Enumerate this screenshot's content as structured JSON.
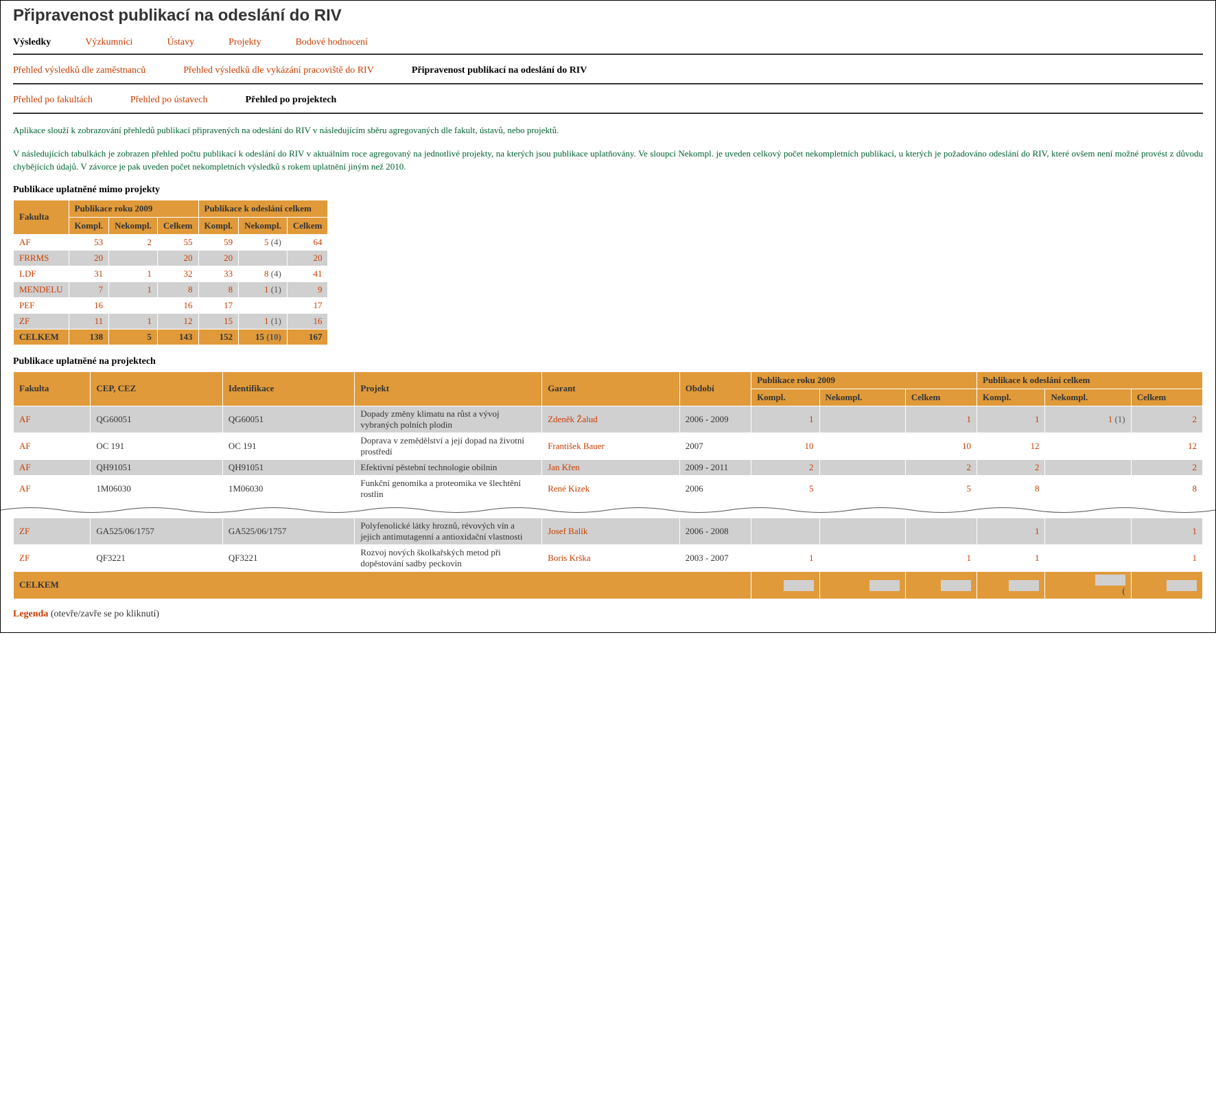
{
  "title": "Připravenost publikací na odeslání do RIV",
  "tabs1": [
    "Výsledky",
    "Výzkumníci",
    "Ústavy",
    "Projekty",
    "Bodové hodnocení"
  ],
  "tabs1_active": 0,
  "tabs2": [
    "Přehled výsledků dle zaměstnanců",
    "Přehled výsledků dle vykázání pracoviště do RIV",
    "Připravenost publikací na odeslání do RIV"
  ],
  "tabs2_active": 2,
  "tabs3": [
    "Přehled po fakultách",
    "Přehled po ústavech",
    "Přehled po projektech"
  ],
  "tabs3_active": 2,
  "desc1": "Aplikace slouží k zobrazování přehledů publikací připravených na odeslání do RIV v následujícím sběru agregovaných dle fakult, ústavů, nebo projektů.",
  "desc2": "V následujících tabulkách je zobrazen přehled počtu publikací k odeslání do RIV v aktuálním roce agregovaný na jednotlivé projekty, na kterých jsou publikace uplatňovány. Ve sloupci Nekompl. je uveden celkový počet nekompletních publikací, u kterých je požadováno odeslání do RIV, které ovšem není možné provést z důvodu chybějících údajů. V závorce je pak uveden počet nekompletních výsledků s rokem uplatnění jiným než 2010.",
  "sec1_title": "Publikace uplatněné mimo projekty",
  "sec2_title": "Publikace uplatněné na projektech",
  "h": {
    "fakulta": "Fakulta",
    "cep": "CEP, CEZ",
    "ident": "Identifikace",
    "projekt": "Projekt",
    "garant": "Garant",
    "obdobi": "Období",
    "pub2009": "Publikace roku 2009",
    "pubcelk": "Publikace k odeslání celkem",
    "kompl": "Kompl.",
    "nekompl": "Nekompl.",
    "celkem": "Celkem"
  },
  "t1_rows": [
    {
      "f": "AF",
      "a": "53",
      "b": "2",
      "c": "55",
      "d": "59",
      "e": "5",
      "ep": "4",
      "g": "64"
    },
    {
      "f": "FRRMS",
      "a": "20",
      "b": "",
      "c": "20",
      "d": "20",
      "e": "",
      "ep": "",
      "g": "20"
    },
    {
      "f": "LDF",
      "a": "31",
      "b": "1",
      "c": "32",
      "d": "33",
      "e": "8",
      "ep": "4",
      "g": "41"
    },
    {
      "f": "MENDELU",
      "a": "7",
      "b": "1",
      "c": "8",
      "d": "8",
      "e": "1",
      "ep": "1",
      "g": "9"
    },
    {
      "f": "PEF",
      "a": "16",
      "b": "",
      "c": "16",
      "d": "17",
      "e": "",
      "ep": "",
      "g": "17"
    },
    {
      "f": "ZF",
      "a": "11",
      "b": "1",
      "c": "12",
      "d": "15",
      "e": "1",
      "ep": "1",
      "g": "16"
    }
  ],
  "t1_total": {
    "label": "CELKEM",
    "a": "138",
    "b": "5",
    "c": "143",
    "d": "152",
    "e": "15",
    "ep": "10",
    "g": "167"
  },
  "t2_rows": [
    {
      "f": "AF",
      "cep": "QG60051",
      "id": "QG60051",
      "proj": "Dopady změny klimatu na růst a vývoj vybraných polních plodin",
      "gar": "Zdeněk Žalud",
      "obd": "2006 - 2009",
      "a": "1",
      "b": "",
      "c": "1",
      "d": "1",
      "e": "1",
      "ep": "1",
      "g": "2"
    },
    {
      "f": "AF",
      "cep": "OC 191",
      "id": "OC 191",
      "proj": "Doprava v zemědělství a její dopad na životní prostředí",
      "gar": "František Bauer",
      "obd": "2007",
      "a": "10",
      "b": "",
      "c": "10",
      "d": "12",
      "e": "",
      "ep": "",
      "g": "12"
    },
    {
      "f": "AF",
      "cep": "QH91051",
      "id": "QH91051",
      "proj": "Efektivní pěstební technologie obilnin",
      "gar": "Jan Křen",
      "obd": "2009 - 2011",
      "a": "2",
      "b": "",
      "c": "2",
      "d": "2",
      "e": "",
      "ep": "",
      "g": "2"
    },
    {
      "f": "AF",
      "cep": "1M06030",
      "id": "1M06030",
      "proj": "Funkční genomika a proteomika ve šlechtění rostlin",
      "gar": "René Kizek",
      "obd": "2006",
      "a": "5",
      "b": "",
      "c": "5",
      "d": "8",
      "e": "",
      "ep": "",
      "g": "8"
    }
  ],
  "t2_rows_after": [
    {
      "f": "ZF",
      "cep": "GA525/06/1757",
      "id": "GA525/06/1757",
      "proj": "Polyfenolické látky hroznů, révových vín a jejich antimutagenní a antioxidační vlastnosti",
      "gar": "Josef Balík",
      "obd": "2006 - 2008",
      "a": "",
      "b": "",
      "c": "",
      "d": "1",
      "e": "",
      "ep": "",
      "g": "1"
    },
    {
      "f": "ZF",
      "cep": "QF3221",
      "id": "QF3221",
      "proj": "Rozvoj nových školkařských metod při dopěstování sadby peckovin",
      "gar": "Boris Krška",
      "obd": "2003 - 2007",
      "a": "1",
      "b": "",
      "c": "1",
      "d": "1",
      "e": "",
      "ep": "",
      "g": "1"
    }
  ],
  "t2_total_label": "CELKEM",
  "legend_label": "Legenda",
  "legend_hint": "(otevře/zavře se po kliknutí)"
}
